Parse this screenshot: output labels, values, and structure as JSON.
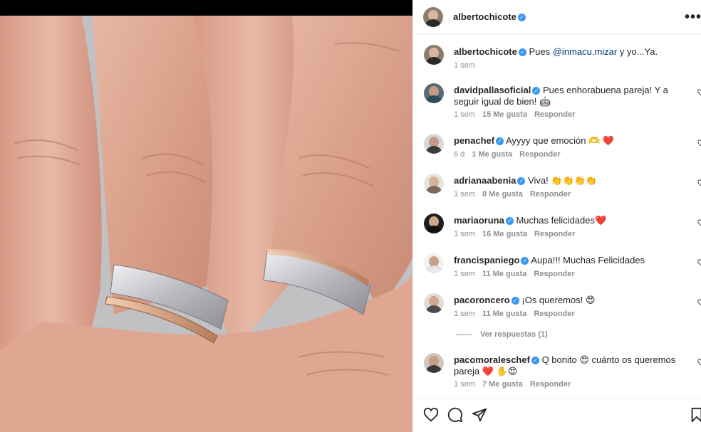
{
  "header": {
    "username": "albertochicote",
    "more_label": "•••"
  },
  "comments": [
    {
      "user": "albertochicote",
      "pre": "Pues ",
      "mention": "@inmacu.mizar",
      "post": " y yo...Ya.",
      "time": "1 sem",
      "likes": "",
      "reply": ""
    },
    {
      "user": "davidpallasoficial",
      "pre": "Pues enhorabuena pareja! Y a seguir igual de bien! 🤖",
      "mention": "",
      "post": "",
      "time": "1 sem",
      "likes": "15 Me gusta",
      "reply": "Responder"
    },
    {
      "user": "penachef",
      "pre": "Ayyyy que emoción 🫶 ❤️",
      "mention": "",
      "post": "",
      "time": "6 d",
      "likes": "1 Me gusta",
      "reply": "Responder"
    },
    {
      "user": "adrianaabenia",
      "pre": "Viva! 👏👏👏👏",
      "mention": "",
      "post": "",
      "time": "1 sem",
      "likes": "8 Me gusta",
      "reply": "Responder"
    },
    {
      "user": "mariaoruna",
      "pre": "Muchas felicidades❤️",
      "mention": "",
      "post": "",
      "time": "1 sem",
      "likes": "16 Me gusta",
      "reply": "Responder"
    },
    {
      "user": "francispaniego",
      "pre": "Aupa!!! Muchas Felicidades",
      "mention": "",
      "post": "",
      "time": "1 sem",
      "likes": "11 Me gusta",
      "reply": "Responder"
    },
    {
      "user": "pacoroncero",
      "pre": "¡Os queremos! 😍",
      "mention": "",
      "post": "",
      "time": "1 sem",
      "likes": "11 Me gusta",
      "reply": "Responder"
    },
    {
      "user": "pacomoraleschef",
      "pre": "Q bonito 😍 cuánto os queremos pareja ❤️ ✋😍",
      "mention": "",
      "post": "",
      "time": "1 sem",
      "likes": "7 Me gusta",
      "reply": "Responder"
    }
  ],
  "view_replies": "Ver respuestas (1)",
  "icons": {
    "verified": "verified-badge-icon",
    "like": "heart-icon",
    "comment": "comment-icon",
    "share": "share-icon",
    "save": "bookmark-icon"
  },
  "colors": {
    "verified": "#3897f0",
    "meta": "#8e8e8e",
    "mention": "#00376b",
    "heart_red": "#ed4956"
  }
}
